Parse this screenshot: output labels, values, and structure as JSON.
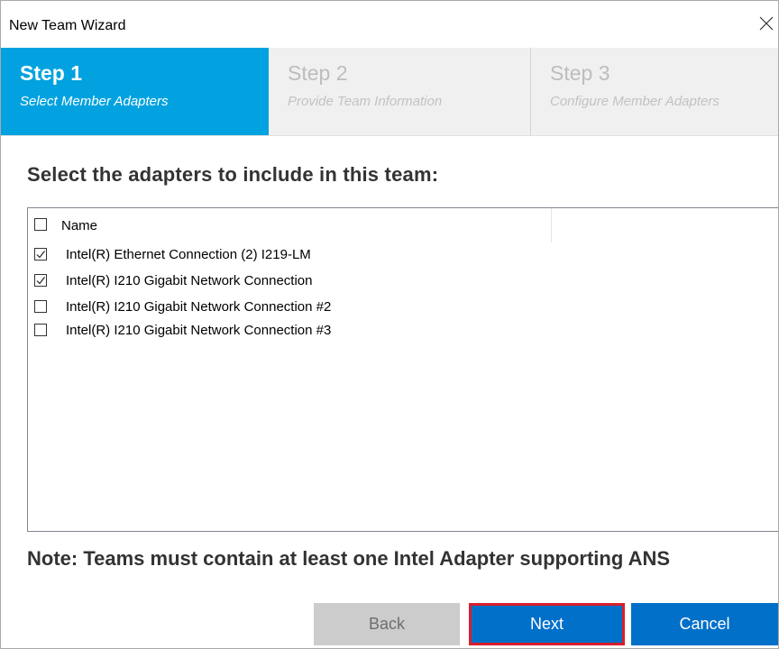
{
  "window": {
    "title": "New Team Wizard",
    "close_icon": "close-icon"
  },
  "steps": [
    {
      "title": "Step 1",
      "subtitle": "Select Member Adapters",
      "active": true
    },
    {
      "title": "Step 2",
      "subtitle": "Provide Team Information",
      "active": false
    },
    {
      "title": "Step 3",
      "subtitle": "Configure Member Adapters",
      "active": false
    }
  ],
  "main": {
    "heading": "Select the adapters to include in this team:",
    "list": {
      "header": {
        "label": "Name",
        "checked": false
      },
      "items": [
        {
          "label": "Intel(R) Ethernet Connection (2) I219-LM",
          "checked": true
        },
        {
          "label": "Intel(R) I210 Gigabit Network Connection",
          "checked": true
        },
        {
          "label": "Intel(R) I210 Gigabit Network Connection #2",
          "checked": false
        },
        {
          "label": "Intel(R) I210 Gigabit Network Connection #3",
          "checked": false
        }
      ]
    },
    "note": "Note: Teams must contain at least one Intel Adapter supporting ANS"
  },
  "buttons": {
    "back": "Back",
    "next": "Next",
    "cancel": "Cancel"
  },
  "colors": {
    "active_step": "#01a2df",
    "primary_button": "#0070c9",
    "disabled_button": "#cccccc",
    "highlight_border": "#d91f2d"
  }
}
